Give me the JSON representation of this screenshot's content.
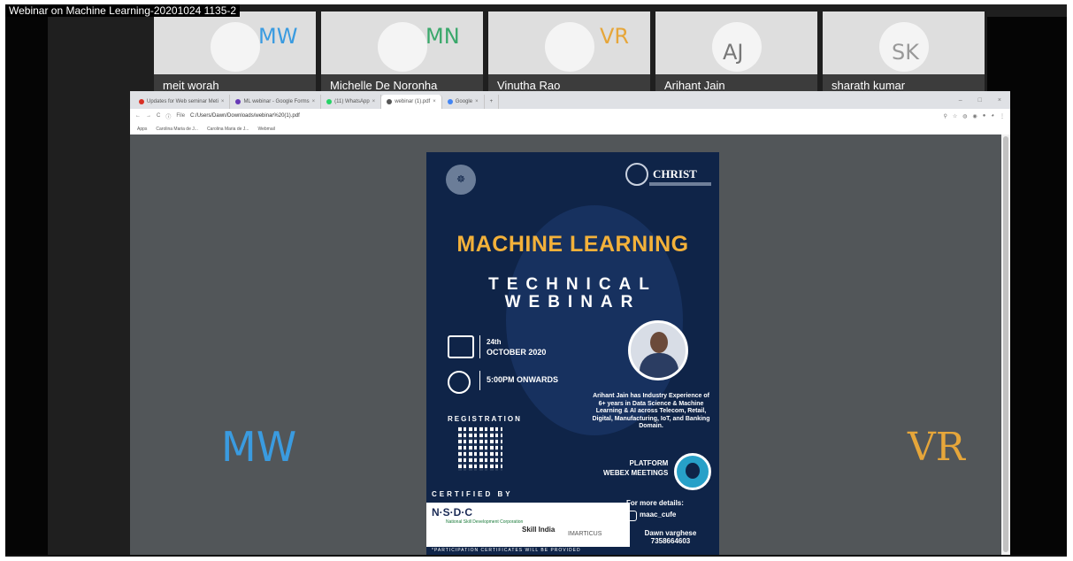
{
  "recording_title": "Webinar on Machine Learning-20201024 1135-2",
  "participants": [
    {
      "initials": "MW",
      "name": "meit worah",
      "color": "#3a9be0"
    },
    {
      "initials": "MN",
      "name": "Michelle De Noronha",
      "color": "#3aa86b"
    },
    {
      "initials": "VR",
      "name": "Vinutha Rao",
      "color": "#e6a63a"
    },
    {
      "initials": "AJ",
      "name": "Arihant Jain",
      "color": "#777777"
    },
    {
      "initials": "SK",
      "name": "sharath kumar",
      "color": "#999999"
    }
  ],
  "browser": {
    "tabs": [
      {
        "label": "Updates for Web seminar Meti",
        "fav_color": "#d93025"
      },
      {
        "label": "ML webinar - Google Forms",
        "fav_color": "#673ab7"
      },
      {
        "label": "(11) WhatsApp",
        "fav_color": "#25d366"
      },
      {
        "label": "webinar (1).pdf",
        "fav_color": "#555555"
      },
      {
        "label": "Google",
        "fav_color": "#4285f4"
      }
    ],
    "new_tab": "+",
    "win_controls": [
      "–",
      "□",
      "×"
    ],
    "nav": {
      "back": "←",
      "forward": "→",
      "reload": "C",
      "info": "ⓘ",
      "file_label": "File"
    },
    "url": "C:/Users/Dawn/Downloads/webinar%20(1).pdf",
    "bookmarks": [
      "Apps",
      "Carolina Maria de J...",
      "Carolina Maria de J...",
      "Webmail"
    ]
  },
  "poster": {
    "logo_left": "☸",
    "logo_right": "CHRIST",
    "title_line1": "MACHINE LEARNING",
    "title_line2": "TECHNICAL",
    "title_line3": "WEBINAR",
    "date_day": "24th",
    "date_month": "OCTOBER 2020",
    "time": "5:00PM ONWARDS",
    "bio": "Arihant Jain has Industry Experience of 6+ years in Data Science & Machine Learning & AI across Telecom, Retail, Digital, Manufacturing, IoT, and Banking Domain.",
    "registration": "REGISTRATION",
    "platform_line1": "PLATFORM",
    "platform_line2": "WEBEX MEETINGS",
    "certified_by": "CERTIFIED BY",
    "nsdc": "N·S·D·C",
    "nsdc_sub": "National Skill Development Corporation",
    "skill_india": "Skill India",
    "imarticus": "IMARTICUS",
    "certificate_note": "*PARTICIPATION CERTIFICATES WILL BE PROVIDED",
    "more_details": "For more details:",
    "instagram": "maac_cufe",
    "contact_name": "Dawn varghese",
    "contact_phone": "7358664603"
  },
  "speaker_labels": {
    "left": "MW",
    "right": "VR"
  }
}
